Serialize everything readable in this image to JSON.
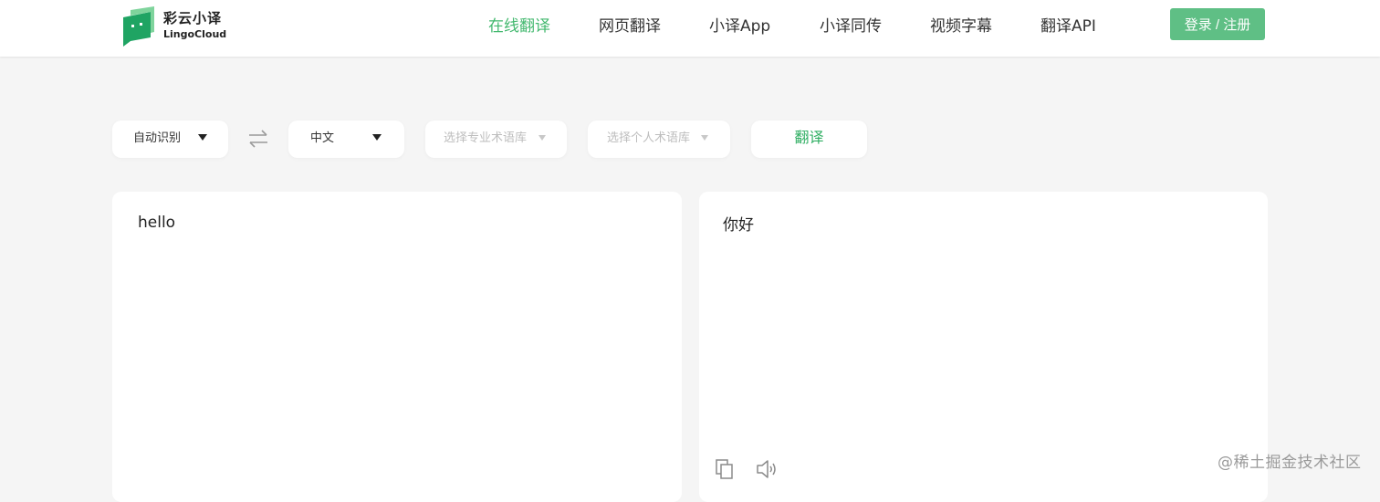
{
  "brand": {
    "name_cn": "彩云小译",
    "name_en": "LingoCloud",
    "accent": "#42b86e"
  },
  "nav": {
    "items": [
      {
        "label": "在线翻译",
        "active": true
      },
      {
        "label": "网页翻译",
        "active": false
      },
      {
        "label": "小译App",
        "active": false
      },
      {
        "label": "小译同传",
        "active": false
      },
      {
        "label": "视频字幕",
        "active": false
      },
      {
        "label": "翻译API",
        "active": false
      }
    ],
    "login_label": "登录 / 注册"
  },
  "toolbar": {
    "source_lang": "自动识别",
    "swap_icon": "swap-arrows-icon",
    "target_lang": "中文",
    "domain_glossary_placeholder": "选择专业术语库",
    "personal_glossary_placeholder": "选择个人术语库",
    "translate_label": "翻译"
  },
  "source": {
    "text": "hello"
  },
  "target": {
    "text": "你好",
    "copy_icon": "copy-icon",
    "speaker_icon": "speaker-icon"
  },
  "watermark": "@稀土掘金技术社区"
}
